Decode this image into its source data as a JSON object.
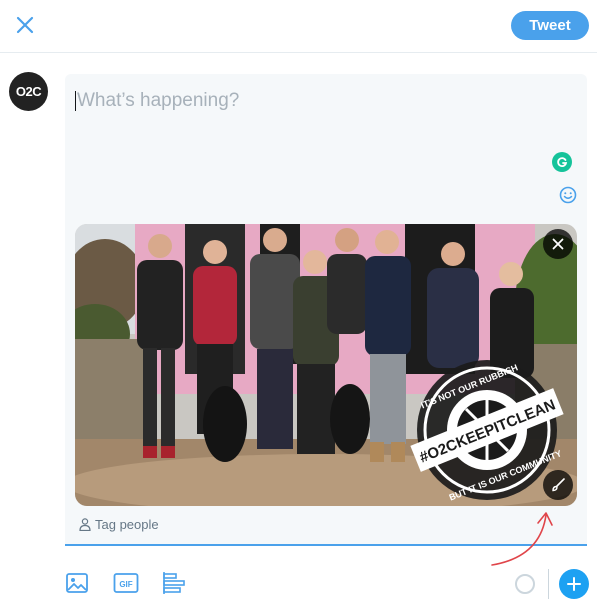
{
  "header": {
    "close_icon": "close-icon",
    "tweet_label": "Tweet"
  },
  "avatar": {
    "text": "O2C"
  },
  "composer": {
    "placeholder": "What’s happening?",
    "grammarly_icon": "grammarly-icon",
    "emoji_icon": "emoji-icon"
  },
  "media": {
    "badge_top": "IT'S NOT OUR RUBBISH",
    "badge_hashtag": "#O2CKEEPITCLEAN",
    "badge_bottom": "BUT IT IS OUR COMMUNITY",
    "remove_icon": "close-icon",
    "edit_icon": "brush-icon"
  },
  "tag_people": {
    "label": "Tag people",
    "icon": "person-icon"
  },
  "toolbar": {
    "image_icon": "image-icon",
    "gif_label": "GIF",
    "poll_icon": "poll-icon",
    "add_icon": "plus-icon"
  },
  "colors": {
    "accent": "#1da1f2",
    "tweet_button": "#4aa1eb",
    "annotation_arrow": "#e0454a"
  }
}
